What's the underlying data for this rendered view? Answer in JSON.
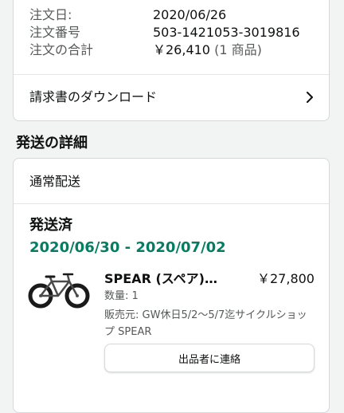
{
  "order_summary": {
    "date_label": "注文日:",
    "date_value": "2020/06/26",
    "number_label": "注文番号",
    "number_value": "503-1421053-3019816",
    "total_label": "注文の合計",
    "total_value": "￥26,410",
    "total_items": "(1 商品)",
    "invoice_link": "請求書のダウンロード",
    "invoice_icon": "chevron-right-icon"
  },
  "shipping": {
    "heading": "発送の詳細",
    "delivery_type": "通常配送",
    "status": "発送済",
    "delivery_range": "2020/06/30 - 2020/07/02",
    "status_color": "#067d62"
  },
  "product": {
    "image_icon": "bicycle-product-image",
    "title": "SPEAR (スペア)…",
    "price": "￥27,800",
    "quantity": "数量: 1",
    "seller": "販売元: GW休日5/2〜5/7迄サイクルショップ SPEAR",
    "contact_button": "出品者に連絡"
  }
}
